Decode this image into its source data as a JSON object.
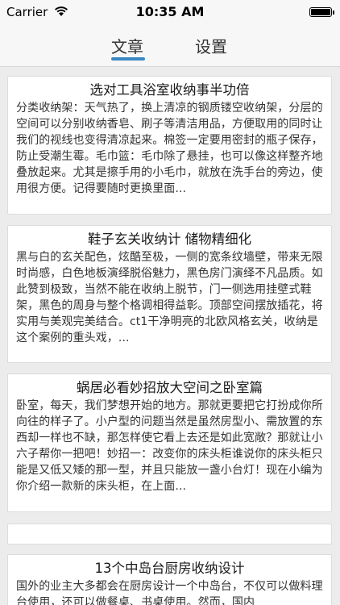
{
  "status_bar": {
    "carrier": "Carrier",
    "time": "10:35 AM"
  },
  "nav": {
    "tabs": [
      {
        "label": "文章",
        "active": true
      },
      {
        "label": "设置",
        "active": false
      }
    ],
    "accent_color": "#3d87c4"
  },
  "articles": [
    {
      "title": "选对工具浴室收纳事半功倍",
      "excerpt": "分类收纳架：天气热了，换上清凉的钢质镂空收纳架，分层的空间可以分别收纳香皂、刷子等清洁用品，方便取用的同时让我们的视线也变得清凉起来。棉签一定要用密封的瓶子保存，防止受潮生霉。毛巾篮：毛巾除了悬挂，也可以像这样整齐地叠放起来。尤其是擦手用的小毛巾，就放在洗手台的旁边，使用很方便。记得要随时更换里面..."
    },
    {
      "title": "鞋子玄关收纳计 储物精细化",
      "excerpt": "黑与白的玄关配色，炫酷至极，一侧的宽条纹墙壁，带来无限时尚感，白色地板演绎脱俗魅力，黑色房门演绎不凡品质。如此赞到极致，当然不能在收纳上脱节，门一侧选用挂壁式鞋架，黑色的周身与整个格调相得益彰。顶部空间摆放插花，将实用与美观完美结合。ct1干净明亮的北欧风格玄关，收纳是这个案例的重头戏，..."
    },
    {
      "title": "蜗居必看妙招放大空间之卧室篇",
      "excerpt": "卧室，每天，我们梦想开始的地方。那就更要把它打扮成你所向往的样子了。小户型的问题当然是虽然房型小、需放置的东西却一样也不缺，那怎样使它看上去还是如此宽敞？那就让小六子帮你一把吧！妙招一：改变你的床头柜谁说你的床头柜只能是又低又矮的那一型，并且只能放一盏小台灯！现在小编为你介绍一款新的床头柜，在上面..."
    },
    {
      "title": "",
      "excerpt": ""
    },
    {
      "title": "13个中岛台厨房收纳设计",
      "excerpt": "国外的业主大多都会在厨房设计一个中岛台，不仅可以做料理台使用，还可以做餐桌、书桌使用。然而，国内"
    }
  ]
}
